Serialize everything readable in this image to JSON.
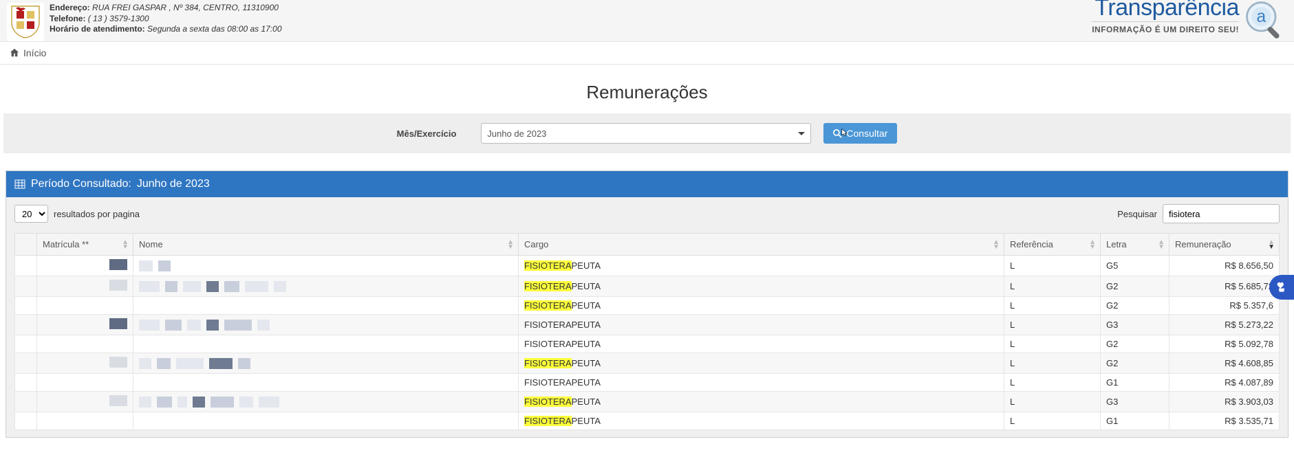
{
  "header": {
    "address_label": "Endereço:",
    "address": "RUA FREI GASPAR , Nº 384, CENTRO, 11310900",
    "phone_label": "Telefone:",
    "phone": "( 13 ) 3579-1300",
    "hours_label": "Horário de atendimento:",
    "hours": "Segunda a sexta das 08:00 as 17:00",
    "brand_title": "Transparência",
    "brand_sub": "INFORMAÇÃO É UM DIREITO SEU!"
  },
  "nav": {
    "home": "Início"
  },
  "page_title": "Remunerações",
  "filter": {
    "label": "Mês/Exercício",
    "selected": "Junho de 2023",
    "button": "Consultar"
  },
  "panel": {
    "period_label": "Período Consultado:",
    "period_value": "Junho de 2023",
    "page_size_value": "20",
    "page_size_label": "resultados por pagina",
    "search_label": "Pesquisar",
    "search_value": "fisiotera"
  },
  "columns": {
    "matricula": "Matrícula **",
    "nome": "Nome",
    "cargo": "Cargo",
    "referencia": "Referência",
    "letra": "Letra",
    "remuneracao": "Remuneração"
  },
  "rows": [
    {
      "cargo_pre": "FISIOTERA",
      "cargo_post": "PEUTA",
      "ref": "L",
      "letra": "G5",
      "rem": "R$ 8.656,50",
      "hl": true
    },
    {
      "cargo_pre": "FISIOTERA",
      "cargo_post": "PEUTA",
      "ref": "L",
      "letra": "G2",
      "rem": "R$ 5.685,72",
      "hl": true
    },
    {
      "cargo_pre": "FISIOTERA",
      "cargo_post": "PEUTA",
      "ref": "L",
      "letra": "G2",
      "rem": "R$ 5.357,6",
      "hl": true
    },
    {
      "cargo_pre": "",
      "cargo_post": "FISIOTERAPEUTA",
      "ref": "L",
      "letra": "G3",
      "rem": "R$ 5.273,22",
      "hl": false
    },
    {
      "cargo_pre": "",
      "cargo_post": "FISIOTERAPEUTA",
      "ref": "L",
      "letra": "G2",
      "rem": "R$ 5.092,78",
      "hl": false
    },
    {
      "cargo_pre": "FISIOTERA",
      "cargo_post": "PEUTA",
      "ref": "L",
      "letra": "G2",
      "rem": "R$ 4.608,85",
      "hl": true
    },
    {
      "cargo_pre": "",
      "cargo_post": "FISIOTERAPEUTA",
      "ref": "L",
      "letra": "G1",
      "rem": "R$ 4.087,89",
      "hl": false
    },
    {
      "cargo_pre": "FISIOTERA",
      "cargo_post": "PEUTA",
      "ref": "L",
      "letra": "G3",
      "rem": "R$ 3.903,03",
      "hl": true
    },
    {
      "cargo_pre": "FISIOTERA",
      "cargo_post": "PEUTA",
      "ref": "L",
      "letra": "G1",
      "rem": "R$ 3.535,71",
      "hl": true
    }
  ]
}
